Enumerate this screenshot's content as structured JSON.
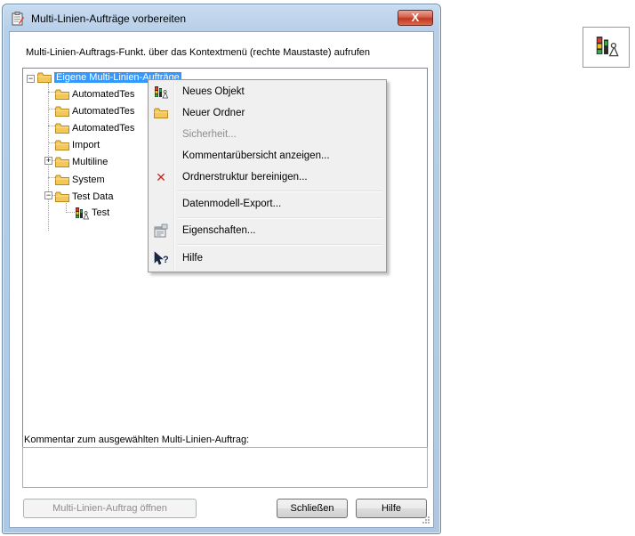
{
  "window": {
    "title": "Multi-Linien-Aufträge vorbereiten",
    "close_label": "X"
  },
  "hint_text": "Multi-Linien-Auftrags-Funkt. über das Kontextmenü (rechte Maustaste) aufrufen",
  "tree": {
    "root": "Eigene Multi-Linien-Aufträge",
    "items": [
      {
        "label": "AutomatedTes",
        "icon": "folder-icon"
      },
      {
        "label": "AutomatedTes",
        "icon": "folder-icon"
      },
      {
        "label": "AutomatedTes",
        "icon": "folder-icon"
      },
      {
        "label": "Import",
        "icon": "folder-icon"
      },
      {
        "label": "Multiline",
        "icon": "folder-icon",
        "expander": "+"
      },
      {
        "label": "System",
        "icon": "folder-icon"
      },
      {
        "label": "Test Data",
        "icon": "folder-icon",
        "expander": "−"
      },
      {
        "label": "Test",
        "icon": "multiline-job-icon"
      }
    ]
  },
  "context_menu": {
    "items": [
      {
        "label": "Neues Objekt",
        "icon": "multiline-job-icon",
        "enabled": true
      },
      {
        "label": "Neuer Ordner",
        "icon": "folder-icon",
        "enabled": true
      },
      {
        "label": "Sicherheit...",
        "icon": "",
        "enabled": false
      },
      {
        "label": "Kommentarübersicht anzeigen...",
        "icon": "",
        "enabled": true
      },
      {
        "label": "Ordnerstruktur bereinigen...",
        "icon": "delete-x-icon",
        "enabled": true
      },
      {
        "label": "Datenmodell-Export...",
        "icon": "",
        "enabled": true
      },
      {
        "label": "Eigenschaften...",
        "icon": "properties-icon",
        "enabled": true
      },
      {
        "label": "Hilfe",
        "icon": "help-icon",
        "enabled": true
      }
    ]
  },
  "comment": {
    "label": "Kommentar zum ausgewählten Multi-Linien-Auftrag:",
    "value": ""
  },
  "buttons": {
    "open": "Multi-Linien-Auftrag öffnen",
    "close": "Schließen",
    "help": "Hilfe"
  },
  "colors": {
    "selection": "#3399ff",
    "close_button": "#c1371f",
    "folder": "#f3c75a"
  }
}
